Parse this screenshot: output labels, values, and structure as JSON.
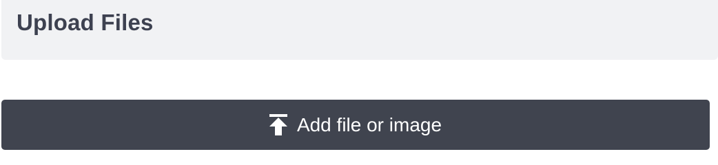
{
  "panel": {
    "title": "Upload Files"
  },
  "upload_button": {
    "label": "Add file or image",
    "icon": "upload-icon"
  },
  "colors": {
    "header_bg": "#f1f2f4",
    "title_text": "#3d4150",
    "button_bg": "#40444f",
    "button_text": "#ffffff"
  }
}
